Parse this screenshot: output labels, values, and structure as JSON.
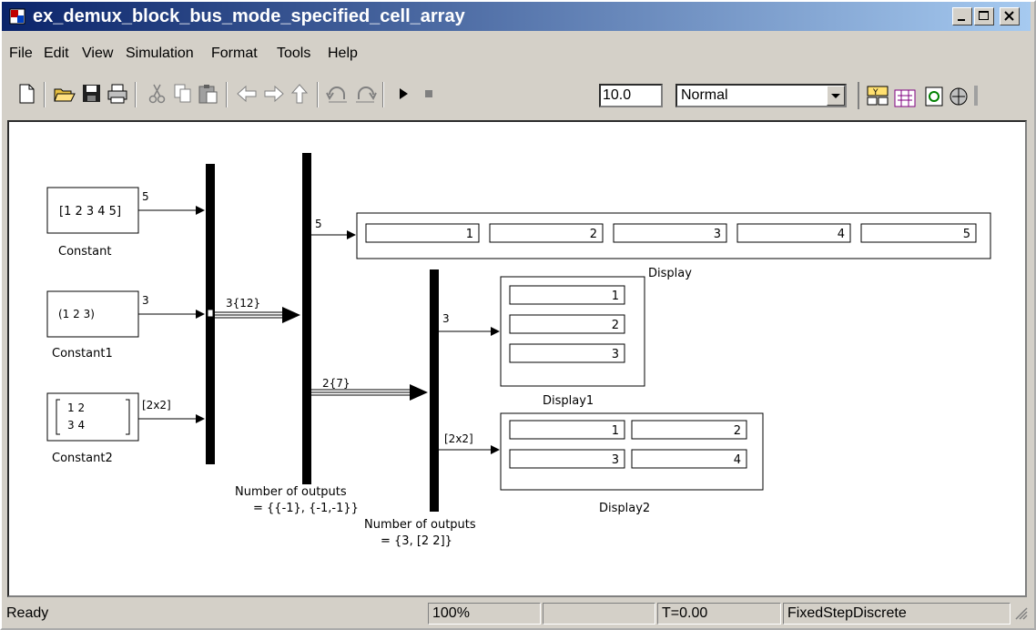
{
  "window": {
    "title": "ex_demux_block_bus_mode_specified_cell_array"
  },
  "menu": [
    "File",
    "Edit",
    "View",
    "Simulation",
    "Format",
    "Tools",
    "Help"
  ],
  "toolbar": {
    "stop_time": "10.0",
    "sim_mode": "Normal",
    "icons": [
      "new-model-icon",
      "open-icon",
      "save-icon",
      "print-icon",
      "cut-icon",
      "copy-icon",
      "paste-icon",
      "back-icon",
      "forward-icon",
      "up-icon",
      "undo-icon",
      "redo-icon",
      "start-simulation-icon",
      "stop-simulation-icon",
      "build-icon",
      "library-browser-icon",
      "refresh-icon",
      "model-explorer-icon"
    ]
  },
  "diagram": {
    "constant": {
      "value": "[1 2 3 4 5]",
      "label": "Constant",
      "signal": "5"
    },
    "constant1": {
      "value": "(1  2  3)",
      "label": "Constant1",
      "signal": "3"
    },
    "constant2": {
      "row1": "1   2",
      "row2": "3   4",
      "label": "Constant2",
      "signal": "[2x2]"
    },
    "bus1": {
      "signal": "3{12}"
    },
    "demux1": {
      "label_line1": "Number of outputs",
      "label_line2": "= {{-1}, {-1,-1}}",
      "out1_signal": "5",
      "out2_signal": "2{7}"
    },
    "demux2": {
      "label_line1": "Number of outputs",
      "label_line2": "= {3, [2 2]}",
      "out1_signal": "3",
      "out2_signal": "[2x2]"
    },
    "display": {
      "label": "Display",
      "values": [
        "1",
        "2",
        "3",
        "4",
        "5"
      ]
    },
    "display1": {
      "label": "Display1",
      "values": [
        "1",
        "2",
        "3"
      ]
    },
    "display2": {
      "label": "Display2",
      "values": [
        "1",
        "2",
        "3",
        "4"
      ]
    }
  },
  "status": {
    "state": "Ready",
    "zoom": "100%",
    "empty": "",
    "time": "T=0.00",
    "solver": "FixedStepDiscrete"
  }
}
